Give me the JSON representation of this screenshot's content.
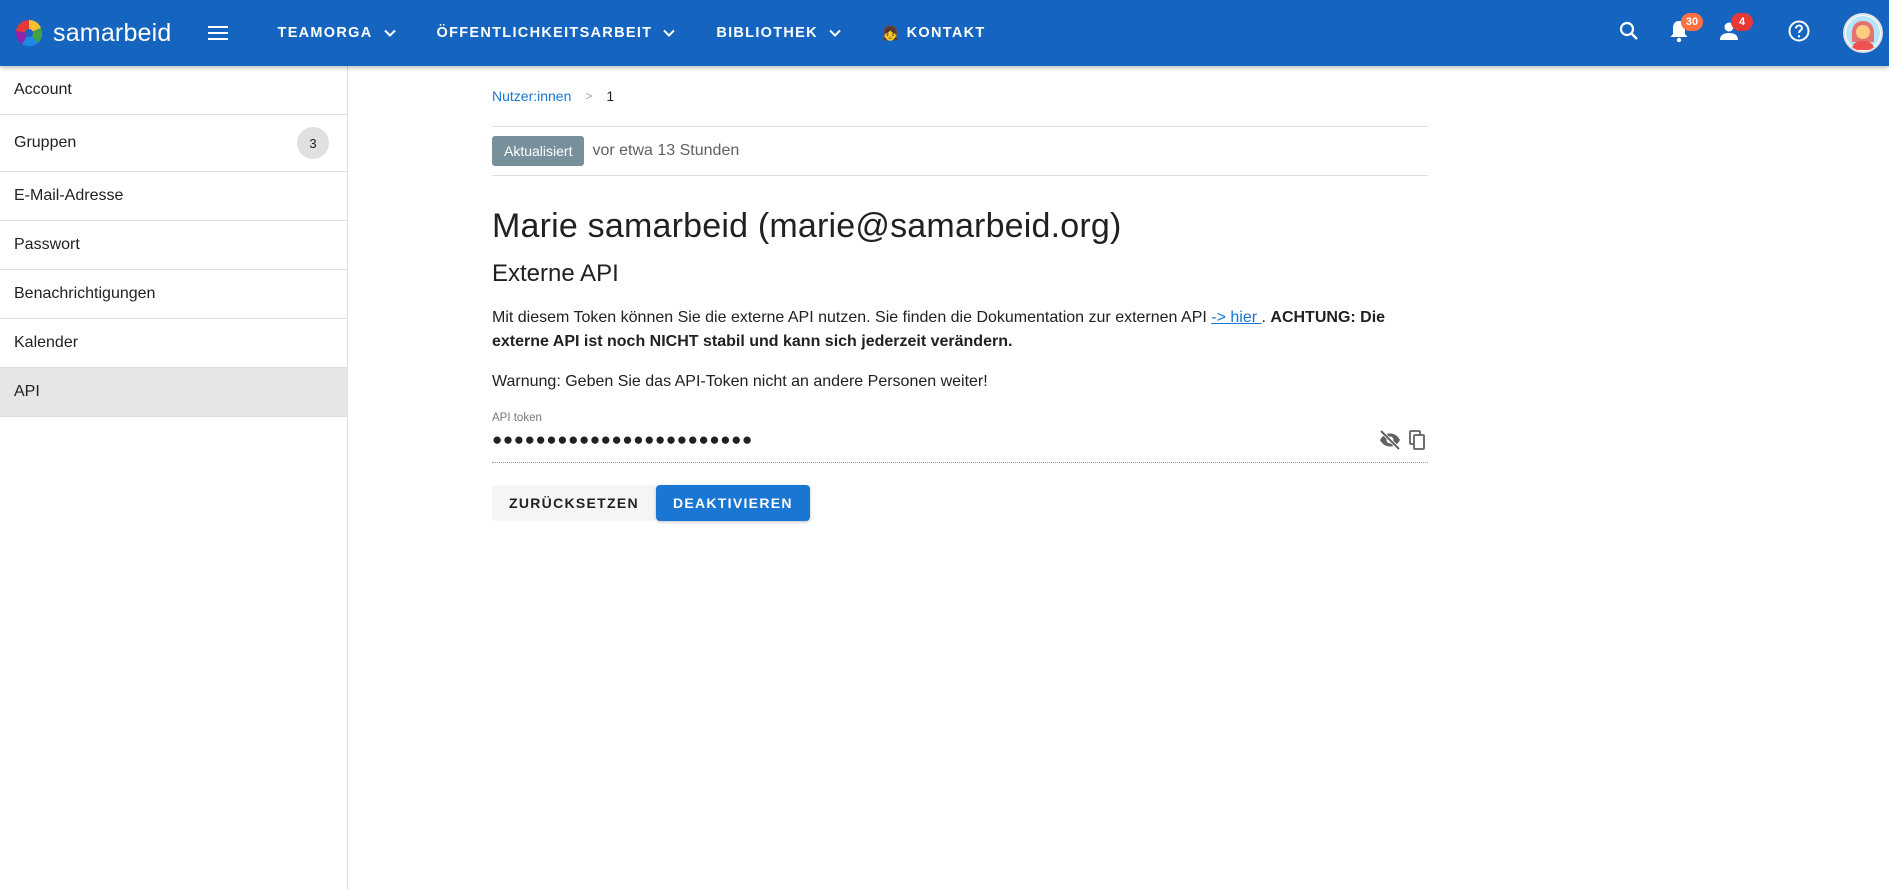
{
  "app": {
    "name": "samarbeid"
  },
  "nav": {
    "items": [
      {
        "label": "Teamorga",
        "has_dropdown": true
      },
      {
        "label": "Öffentlichkeitsarbeit",
        "has_dropdown": true
      },
      {
        "label": "Bibliothek",
        "has_dropdown": true
      },
      {
        "label": "Kontakt",
        "emoji": "👧"
      }
    ]
  },
  "header": {
    "notifications_count": "30",
    "contacts_count": "4",
    "colors": {
      "appbar": "#1565c0",
      "notifications_badge": "#ff7043",
      "contacts_badge": "#e53935"
    }
  },
  "sidebar": {
    "items": [
      {
        "label": "Account"
      },
      {
        "label": "Gruppen",
        "count": "3"
      },
      {
        "label": "E-Mail-Adresse"
      },
      {
        "label": "Passwort"
      },
      {
        "label": "Benachrichtigungen"
      },
      {
        "label": "Kalender"
      },
      {
        "label": "API",
        "active": true
      }
    ]
  },
  "breadcrumb": {
    "parent": "Nutzer:innen",
    "separator": ">",
    "current": "1"
  },
  "status": {
    "chip": "Aktualisiert",
    "time": "vor etwa 13 Stunden"
  },
  "main": {
    "title": "Marie samarbeid (marie@samarbeid.org)",
    "section_title": "Externe API",
    "info_text": "Mit diesem Token können Sie die externe API nutzen. Sie finden die Dokumentation zur externen API ",
    "info_link": "-> hier ",
    "info_after_link": ". ",
    "info_bold": "ACHTUNG: Die externe API ist noch NICHT stabil und kann sich jederzeit verändern.",
    "warning": "Warnung: Geben Sie das API-Token nicht an andere Personen weiter!"
  },
  "token": {
    "label": "API token",
    "value": "●●●●●●●●●●●●●●●●●●●●●●●●"
  },
  "buttons": {
    "reset": "Zurücksetzen",
    "deactivate": "Deaktivieren"
  }
}
